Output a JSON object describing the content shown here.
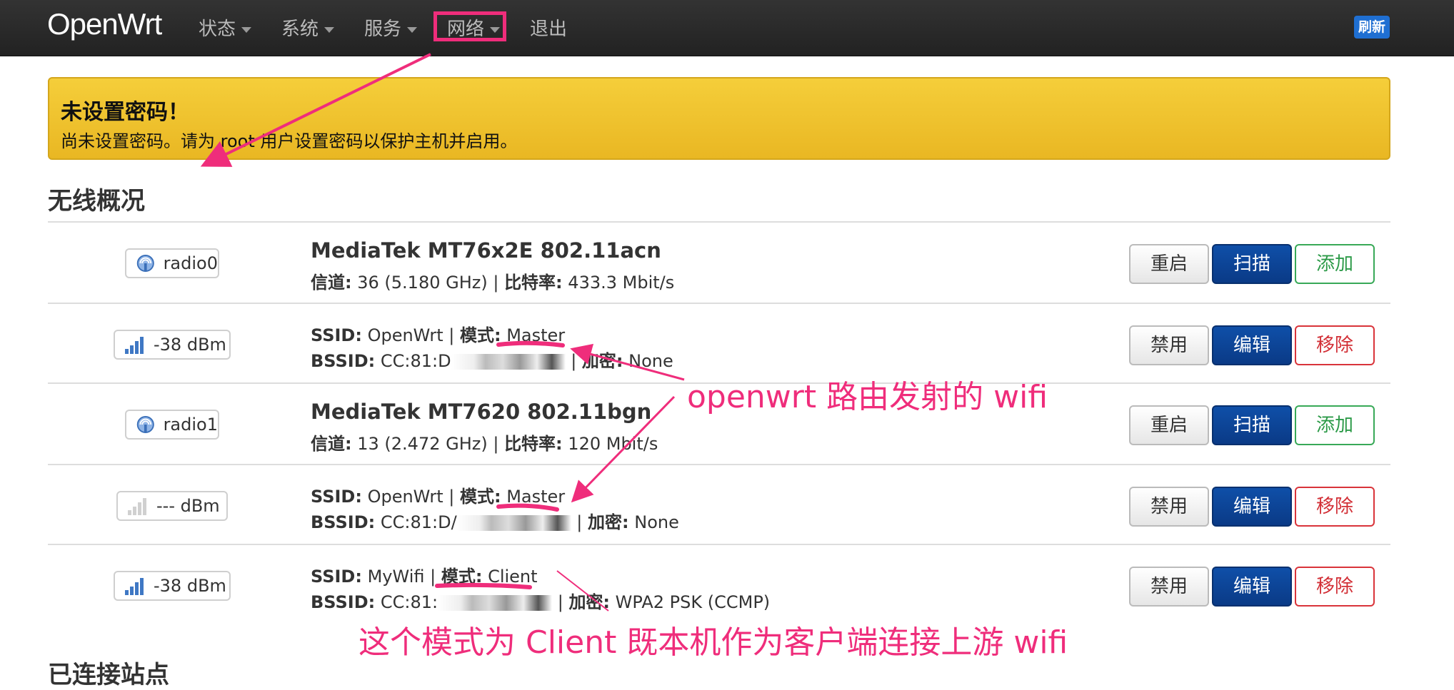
{
  "nav": {
    "brand": "OpenWrt",
    "items": [
      "状态",
      "系统",
      "服务",
      "网络"
    ],
    "logout": "退出",
    "refresh": "刷新"
  },
  "alert": {
    "title": "未设置密码！",
    "body": "尚未设置密码。请为 root 用户设置密码以保护主机并启用。"
  },
  "section_title": "无线概况",
  "rows": [
    {
      "badge": "radio0",
      "title": "MediaTek MT76x2E 802.11acn",
      "l2_label1": "信道:",
      "l2_val1": " 36 (5.180 GHz) | ",
      "l2_label2": "比特率:",
      "l2_val2": " 433.3 Mbit/s",
      "btn1": "重启",
      "btn2": "扫描",
      "btn3": "添加"
    },
    {
      "badge": "-38 dBm",
      "l1_label1": "SSID:",
      "l1_val1": " OpenWrt | ",
      "l1_label2": "模式:",
      "l1_val2": " Master",
      "l2_label1": "BSSID:",
      "l2_val1": " CC:81:D",
      "l2_label2": "加密:",
      "l2_val2": " None",
      "btn1": "禁用",
      "btn2": "编辑",
      "btn3": "移除"
    },
    {
      "badge": "radio1",
      "title": "MediaTek MT7620 802.11bgn",
      "l2_label1": "信道:",
      "l2_val1": " 13 (2.472 GHz) | ",
      "l2_label2": "比特率:",
      "l2_val2": " 120 Mbit/s",
      "btn1": "重启",
      "btn2": "扫描",
      "btn3": "添加"
    },
    {
      "badge": "--- dBm",
      "l1_label1": "SSID:",
      "l1_val1": " OpenWrt | ",
      "l1_label2": "模式:",
      "l1_val2": " Master",
      "l2_label1": "BSSID:",
      "l2_val1": " CC:81:D/",
      "l2_label2": "加密:",
      "l2_val2": " None",
      "btn1": "禁用",
      "btn2": "编辑",
      "btn3": "移除"
    },
    {
      "badge": "-38 dBm",
      "l1_label1": "SSID:",
      "l1_val1": " MyWifi | ",
      "l1_label2": "模式:",
      "l1_val2": " Client",
      "l2_label1": "BSSID:",
      "l2_val1": " CC:81:",
      "l2_label2": "加密:",
      "l2_val2": " WPA2 PSK (CCMP)",
      "btn1": "禁用",
      "btn2": "编辑",
      "btn3": "移除"
    }
  ],
  "annotations": {
    "a1": "openwrt 路由发射的 wifi",
    "a2": "这个模式为 Client 既本机作为客户端连接上游 wifi"
  },
  "bottom_cut": "已连接站点",
  "colors": {
    "accent_pink": "#ef2d7b",
    "primary_blue": "#0f4fa8",
    "alert_yellow": "#f0c430"
  }
}
